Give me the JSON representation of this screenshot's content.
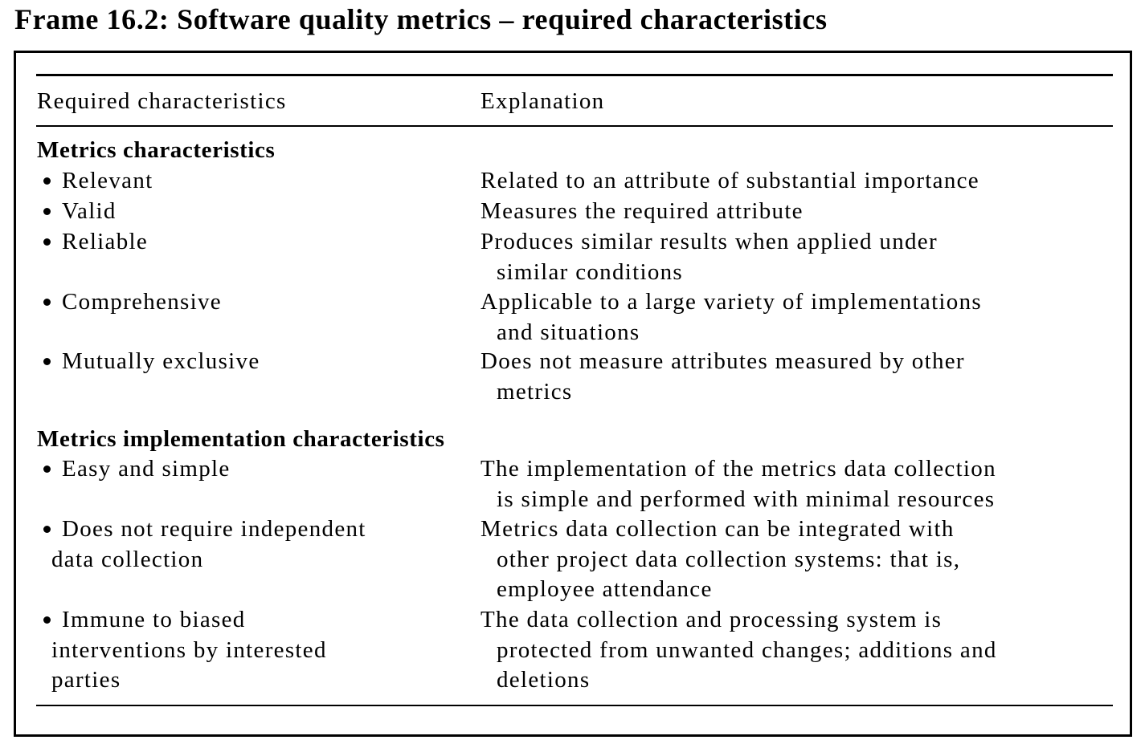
{
  "title": "Frame 16.2:  Software quality metrics – required characteristics",
  "table": {
    "headers": {
      "characteristics": "Required characteristics",
      "explanation": "Explanation"
    },
    "sections": [
      {
        "heading": "Metrics characteristics",
        "rows": [
          {
            "characteristic": [
              "Relevant"
            ],
            "explanation": [
              "Related to an attribute of substantial importance"
            ]
          },
          {
            "characteristic": [
              "Valid"
            ],
            "explanation": [
              "Measures the required attribute"
            ]
          },
          {
            "characteristic": [
              "Reliable"
            ],
            "explanation": [
              "Produces similar results when applied under",
              "similar conditions"
            ]
          },
          {
            "characteristic": [
              "Comprehensive"
            ],
            "explanation": [
              "Applicable to a large variety of implementations",
              "and situations"
            ]
          },
          {
            "characteristic": [
              "Mutually exclusive"
            ],
            "explanation": [
              "Does not measure attributes measured by other",
              "metrics"
            ]
          }
        ]
      },
      {
        "heading": "Metrics implementation characteristics",
        "rows": [
          {
            "characteristic": [
              "Easy and simple"
            ],
            "explanation": [
              "The implementation of the metrics data collection",
              "is simple and performed with minimal resources"
            ]
          },
          {
            "characteristic": [
              "Does not require independent",
              "data collection"
            ],
            "explanation": [
              "Metrics data collection can be integrated with",
              "other project data collection systems: that is,",
              "employee attendance"
            ]
          },
          {
            "characteristic": [
              "Immune to biased",
              "interventions by interested",
              "parties"
            ],
            "explanation": [
              "The data collection and processing system is",
              "protected from unwanted changes; additions and",
              "deletions"
            ]
          }
        ]
      }
    ]
  }
}
